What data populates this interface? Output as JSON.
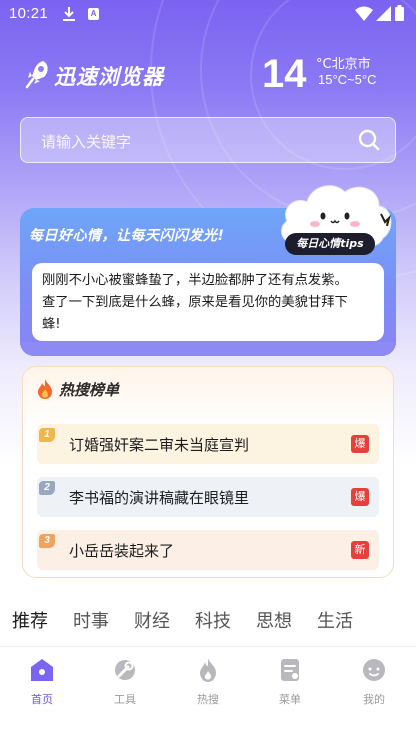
{
  "status_bar": {
    "time": "10:21",
    "badge": "A"
  },
  "brand": {
    "name": "迅速浏览器"
  },
  "weather": {
    "temperature": "14",
    "unit_city": "°C北京市",
    "range": "15°C~5°C"
  },
  "search": {
    "placeholder": "请输入关键字"
  },
  "mood_card": {
    "title": "每日好心情，让每天闪闪发光!",
    "tag": "每日心情tips",
    "lines": [
      "刚刚不小心被蜜蜂蛰了，半边脸都肿了还有点发紫。",
      "查了一下到底是什么蜂，原来是看见你的美貌甘拜下",
      "蜂!"
    ]
  },
  "hot_list": {
    "title": "热搜榜单",
    "items": [
      {
        "rank": "1",
        "title": "订婚强奸案二审未当庭宣判",
        "badge": "爆"
      },
      {
        "rank": "2",
        "title": "李书福的演讲稿藏在眼镜里",
        "badge": "爆"
      },
      {
        "rank": "3",
        "title": "小岳岳装起来了",
        "badge": "新"
      }
    ]
  },
  "category_tabs": [
    "推荐",
    "时事",
    "财经",
    "科技",
    "思想",
    "生活"
  ],
  "bottom_nav": [
    {
      "label": "首页",
      "icon": "home-icon",
      "active": true
    },
    {
      "label": "工具",
      "icon": "tools-icon",
      "active": false
    },
    {
      "label": "热搜",
      "icon": "flame-icon",
      "active": false
    },
    {
      "label": "菜单",
      "icon": "menu-icon",
      "active": false
    },
    {
      "label": "我的",
      "icon": "profile-icon",
      "active": false
    }
  ],
  "colors": {
    "accent": "#6d58ee",
    "hot_badge": "#e5413a",
    "rank1": "#f0b54b",
    "rank2": "#9aa8bf",
    "rank3": "#f2a35b"
  }
}
